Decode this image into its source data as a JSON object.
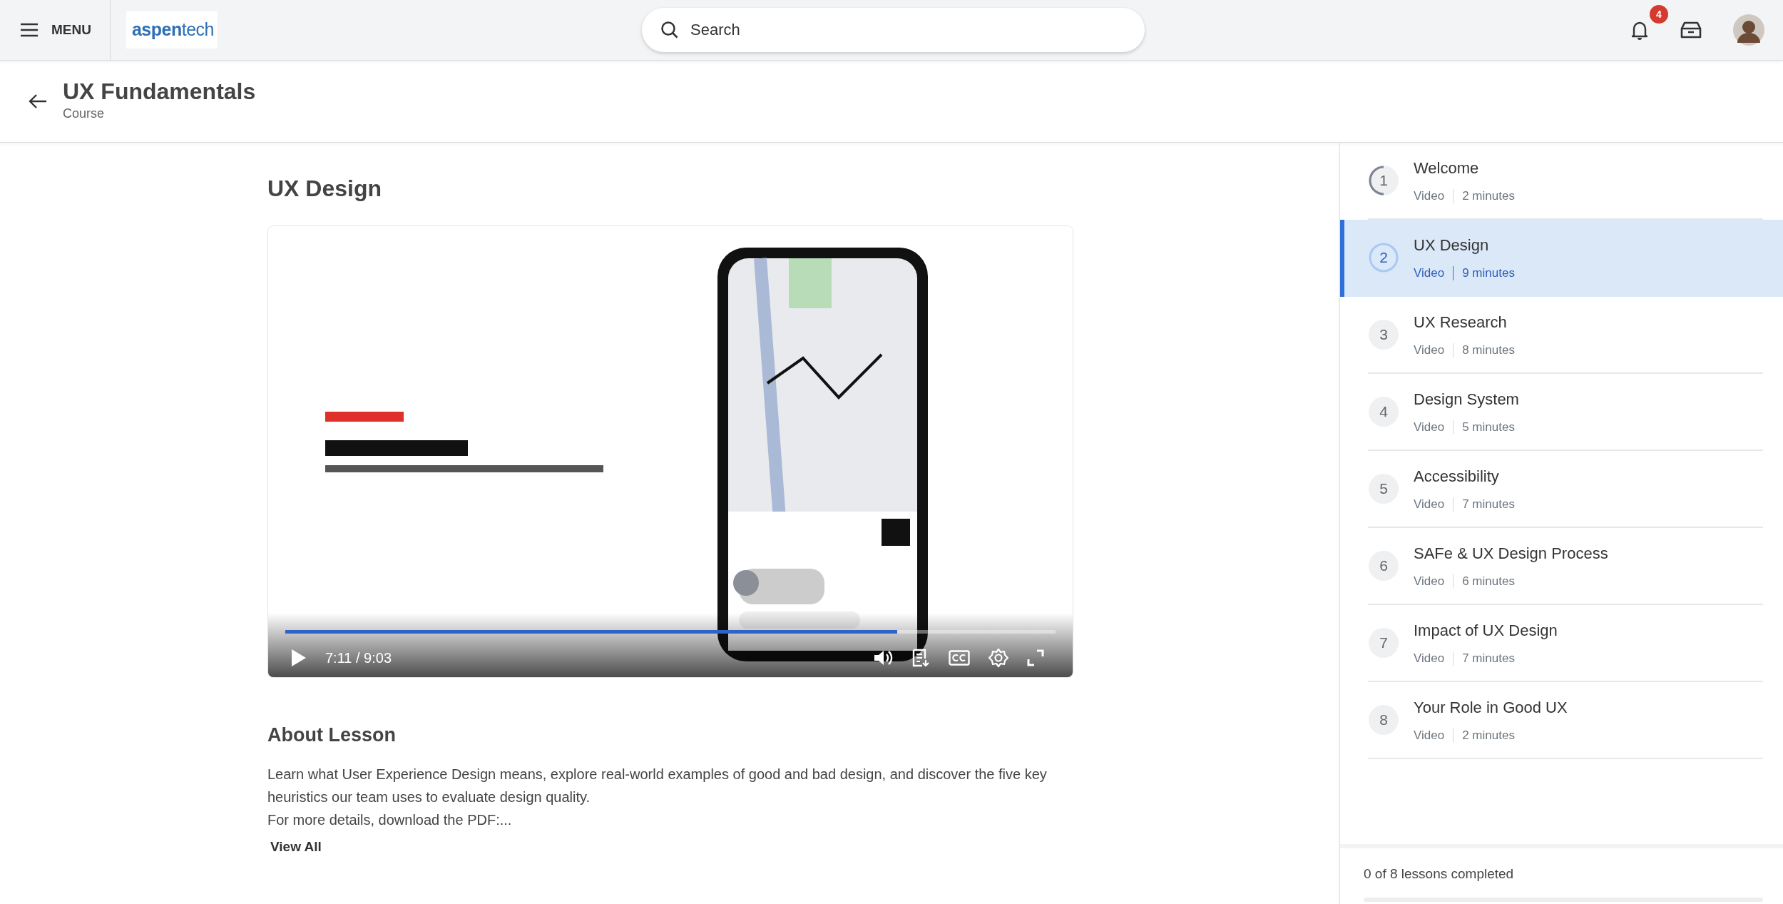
{
  "top_bar": {
    "menu_label": "MENU",
    "logo_text": "**aspen**tech",
    "search": {
      "placeholder": "Search"
    },
    "notifications_count": "4"
  },
  "course": {
    "title": "UX Fundamentals",
    "subtitle": "Course"
  },
  "lesson": {
    "title": "UX Design",
    "video": {
      "kind": "picture",
      "time": "7:11 / 9:03",
      "level": 0.794
    },
    "about_heading": "About Lesson",
    "about_text": "Learn what User Experience Design means, explore real-world examples of good and bad design, and discover the five key heuristics our team uses to evaluate design quality.",
    "about_more": "For more details, download the PDF:...",
    "view_all": "View All"
  },
  "lessons": [
    {
      "number": "1",
      "title": "Welcome",
      "type": "Video",
      "duration": "2 minutes",
      "selected": false,
      "in_progress": true
    },
    {
      "number": "2",
      "title": "UX Design",
      "type": "Video",
      "duration": "9 minutes",
      "selected": true,
      "in_progress": false
    },
    {
      "number": "3",
      "title": "UX Research",
      "type": "Video",
      "duration": "8 minutes",
      "selected": false,
      "in_progress": false
    },
    {
      "number": "4",
      "title": "Design System",
      "type": "Video",
      "duration": "5 minutes",
      "selected": false,
      "in_progress": false
    },
    {
      "number": "5",
      "title": "Accessibility",
      "type": "Video",
      "duration": "7 minutes",
      "selected": false,
      "in_progress": false
    },
    {
      "number": "6",
      "title": "SAFe & UX Design Process",
      "type": "Video",
      "duration": "6 minutes",
      "selected": false,
      "in_progress": false
    },
    {
      "number": "7",
      "title": "Impact of UX Design",
      "type": "Video",
      "duration": "7 minutes",
      "selected": false,
      "in_progress": false
    },
    {
      "number": "8",
      "title": "Your Role in Good UX",
      "type": "Video",
      "duration": "2 minutes",
      "selected": false,
      "in_progress": false
    }
  ],
  "progress": {
    "text": "0 of 8 lessons completed",
    "level": 0
  }
}
